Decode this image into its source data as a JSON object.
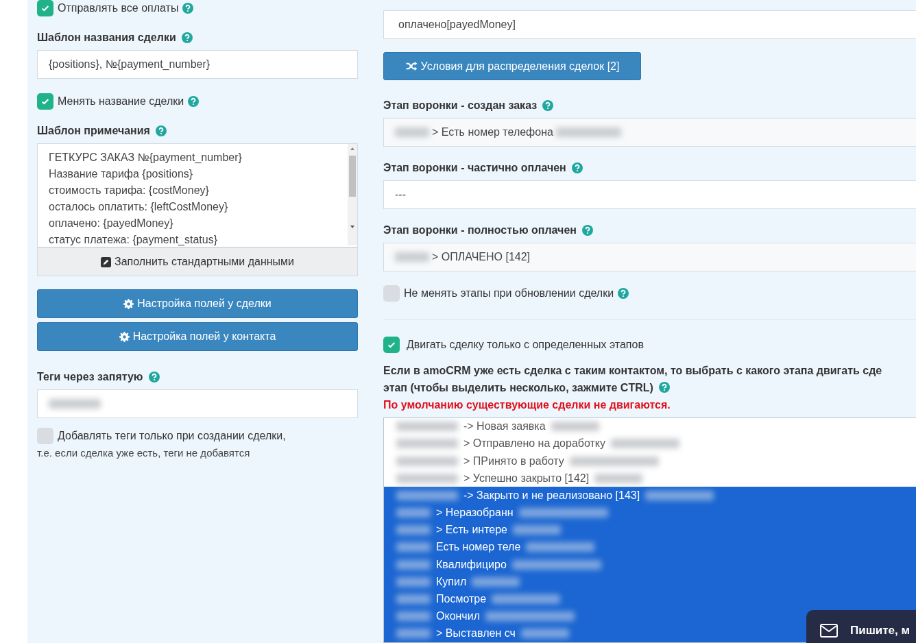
{
  "left": {
    "send_all_payments": {
      "label": "Отправлять все оплаты",
      "checked": true
    },
    "deal_name_template": {
      "label": "Шаблон названия сделки",
      "value": "{positions}, №{payment_number}"
    },
    "change_deal_name": {
      "label": "Менять название сделки",
      "checked": true
    },
    "note_template": {
      "label": "Шаблон примечания",
      "lines": [
        "ГЕТКУРС ЗАКАЗ №{payment_number}",
        "Название тарифа {positions}",
        "стоимость тарифа: {costMoney}",
        "осталось оплатить: {leftCostMoney}",
        "оплачено: {payedMoney}",
        "статус платежа: {payment_status}"
      ]
    },
    "fill_default_button": "Заполнить стандартными данными",
    "buttons": [
      "Настройка полей у сделки",
      "Настройка полей у контакта"
    ],
    "tags": {
      "label": "Теги через запятую"
    },
    "tags_on_create": {
      "label": "Добавлять теги только при создании сделки,",
      "note": "т.е. если сделка уже есть, теги не добавятся",
      "checked": false
    }
  },
  "right": {
    "budget_value": "оплачено[payedMoney]",
    "conditions_button": "Условия для распределения сделок [2]",
    "stages": [
      {
        "label": "Этап воронки - создан заказ",
        "value": "> Есть номер телефона"
      },
      {
        "label": "Этап воронки - частично оплачен",
        "value": "---"
      },
      {
        "label": "Этап воронки - полностью оплачен",
        "value": "> ОПЛАЧЕНО [142]"
      }
    ],
    "keep_stages": {
      "label": "Не менять этапы при обновлении сделки",
      "checked": false
    },
    "move_only_from": {
      "label": "Двигать сделку только с определенных этапов",
      "checked": true
    },
    "hint_line_1": "Если в amoCRM уже есть сделка с таким контактом, то выбрать с какого этапа двигать сде",
    "hint_line_2": "этап (чтобы выделить несколько, зажмите CTRL)",
    "warning": "По умолчанию существующие сделки не двигаются.",
    "stage_options": [
      {
        "text": "-> Новая заявка",
        "selected": false
      },
      {
        "text": "> Отправлено на доработку",
        "selected": false
      },
      {
        "text": "> ПРинято в работу",
        "selected": false
      },
      {
        "text": "> Успешно закрыто [142]",
        "selected": false
      },
      {
        "text": "-> Закрыто и не реализовано [143]",
        "selected": true
      },
      {
        "text": "> Неразобранн",
        "selected": true
      },
      {
        "text": "> Есть интере",
        "selected": true
      },
      {
        "text": "Есть номер теле",
        "selected": true
      },
      {
        "text": "Квалифициро",
        "selected": true
      },
      {
        "text": "Купил",
        "selected": true
      },
      {
        "text": "Посмотре",
        "selected": true
      },
      {
        "text": "Окончил",
        "selected": true
      },
      {
        "text": "> Выставлен сч",
        "selected": true
      }
    ]
  },
  "chat_widget": {
    "label": "Пишите, м"
  }
}
